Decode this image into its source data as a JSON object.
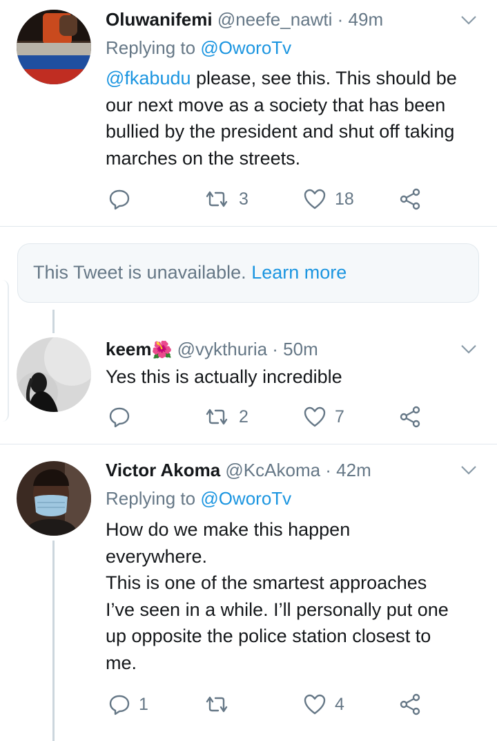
{
  "tweets": [
    {
      "name": "Oluwanifemi",
      "handle": "@neefe_nawti",
      "time": "49m",
      "replying_prefix": "Replying to ",
      "replying_to": "@OworoTv",
      "mention": "@fkabudu",
      "text": " please, see this. This should be our next move as a society that has been bullied by the president and shut off taking marches on the streets.",
      "replies": "",
      "retweets": "3",
      "likes": "18"
    },
    {
      "name": "keem",
      "emoji": "🌺",
      "handle": "@vykthuria",
      "time": "50m",
      "text": "Yes this is actually incredible",
      "replies": "",
      "retweets": "2",
      "likes": "7"
    },
    {
      "name": "Victor Akoma",
      "handle": "@KcAkoma",
      "time": "42m",
      "replying_prefix": "Replying to ",
      "replying_to": "@OworoTv",
      "text_lines": [
        "How do we make this happen",
        "everywhere.",
        "This is one of the smartest approaches",
        "I’ve seen in a while. I’ll personally put one",
        "up opposite the police station closest to",
        "me."
      ],
      "replies": "1",
      "retweets": "",
      "likes": "4"
    }
  ],
  "unavailable": {
    "text": "This Tweet is unavailable.",
    "link": "Learn more"
  },
  "separator": " · ",
  "icons": [
    "reply-icon",
    "retweet-icon",
    "like-icon",
    "share-icon",
    "caret-down-icon"
  ],
  "colors": {
    "link": "#1b95e0",
    "muted": "#657786",
    "divider": "#e1e8ed",
    "thread": "#ccd6dd"
  }
}
